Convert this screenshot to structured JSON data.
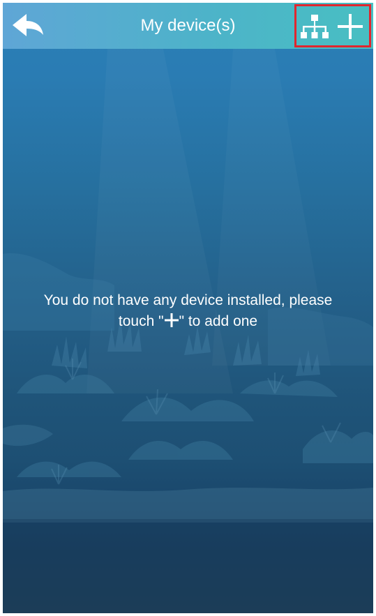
{
  "header": {
    "title": "My device(s)",
    "back_icon": "back-arrow-icon",
    "network_icon": "network-topology-icon",
    "add_icon": "plus-icon"
  },
  "empty_state": {
    "line1": "You do not have any device installed, please",
    "prefix": "touch \"",
    "suffix": "\" to add one",
    "inline_icon": "plus-icon"
  },
  "colors": {
    "header_start": "#5fa6d6",
    "header_end": "#48bfc2",
    "highlight_border": "#e0262e",
    "text": "#ffffff"
  }
}
